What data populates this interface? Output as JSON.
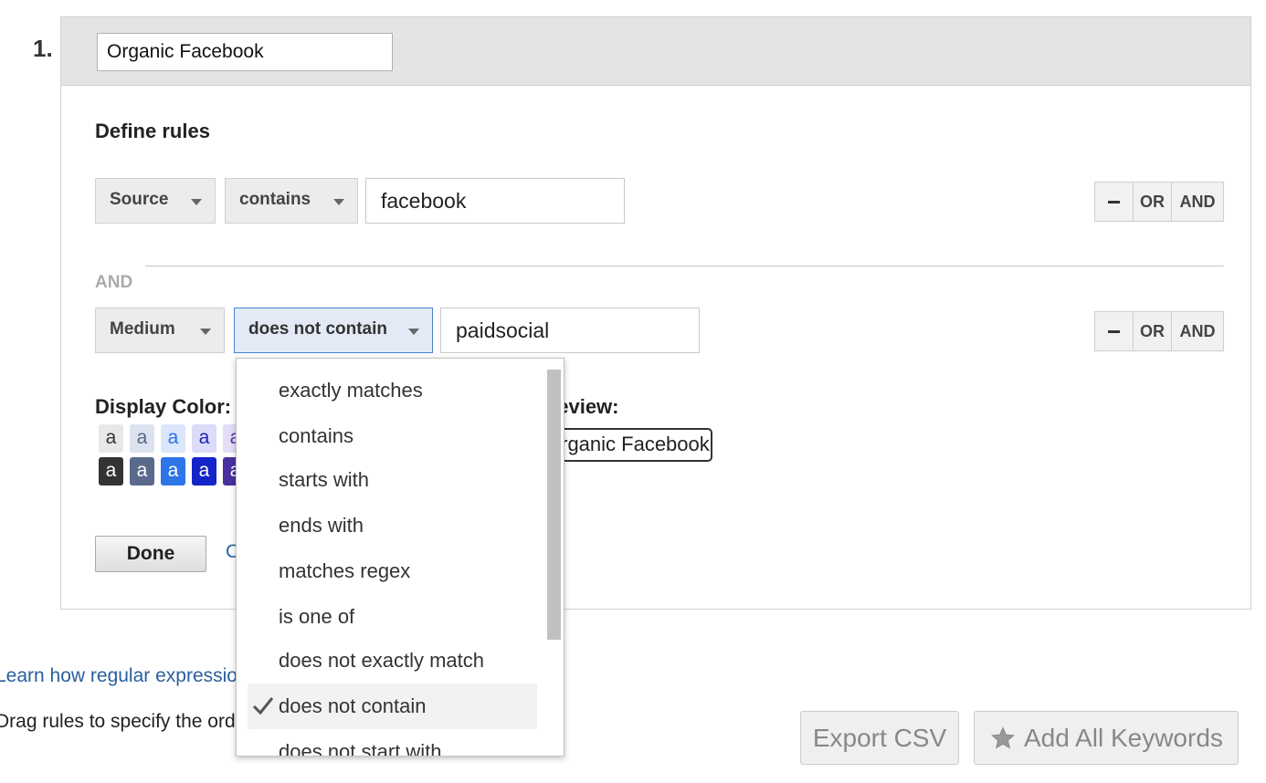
{
  "rule_number": "1.",
  "rule_name": "Organic Facebook",
  "define_rules_title": "Define rules",
  "rules": [
    {
      "dimension": "Source",
      "operator": "contains",
      "value": "facebook"
    },
    {
      "dimension": "Medium",
      "operator": "does not contain",
      "value": "paidsocial"
    }
  ],
  "row_controls": {
    "minus": "",
    "or": "OR",
    "and": "AND"
  },
  "and_separator": "AND",
  "display_color_label": "Display Color:",
  "swatches": {
    "light": [
      {
        "text": "a",
        "bg": "#e8e8e8",
        "fg": "#333333"
      },
      {
        "text": "a",
        "bg": "#dde3ee",
        "fg": "#556688"
      },
      {
        "text": "a",
        "bg": "#dae6fb",
        "fg": "#2f6fe8"
      },
      {
        "text": "a",
        "bg": "#dcdcf8",
        "fg": "#1c22b8"
      },
      {
        "text": "a",
        "bg": "#e4ddf6",
        "fg": "#5533aa"
      }
    ],
    "dark": [
      {
        "text": "a",
        "bg": "#333333",
        "fg": "#ffffff"
      },
      {
        "text": "a",
        "bg": "#5b6a8c",
        "fg": "#ffffff"
      },
      {
        "text": "a",
        "bg": "#2f74e8",
        "fg": "#ffffff"
      },
      {
        "text": "a",
        "bg": "#1524c8",
        "fg": "#ffffff"
      },
      {
        "text": "a",
        "bg": "#4a2fa0",
        "fg": "#ffffff"
      }
    ]
  },
  "preview_label": "Preview:",
  "preview_chip_text": "Organic Facebook",
  "done_label": "Done",
  "cancel_label": "Cancel",
  "learn_link": "Learn how regular expressions",
  "drag_text": "Drag rules to specify the order",
  "export_label": "Export CSV",
  "add_keywords_label": "Add All Keywords",
  "operator_menu": {
    "items": [
      "exactly matches",
      "contains",
      "starts with",
      "ends with",
      "matches regex",
      "is one of",
      "does not exactly match",
      "does not contain",
      "does not start with"
    ],
    "selected": "does not contain"
  },
  "colors": {
    "link": "#2a64a8",
    "active_border": "#4a7fd0"
  },
  "icons": {
    "star": "star-icon",
    "check": "check-icon",
    "caret": "caret-down-icon"
  }
}
